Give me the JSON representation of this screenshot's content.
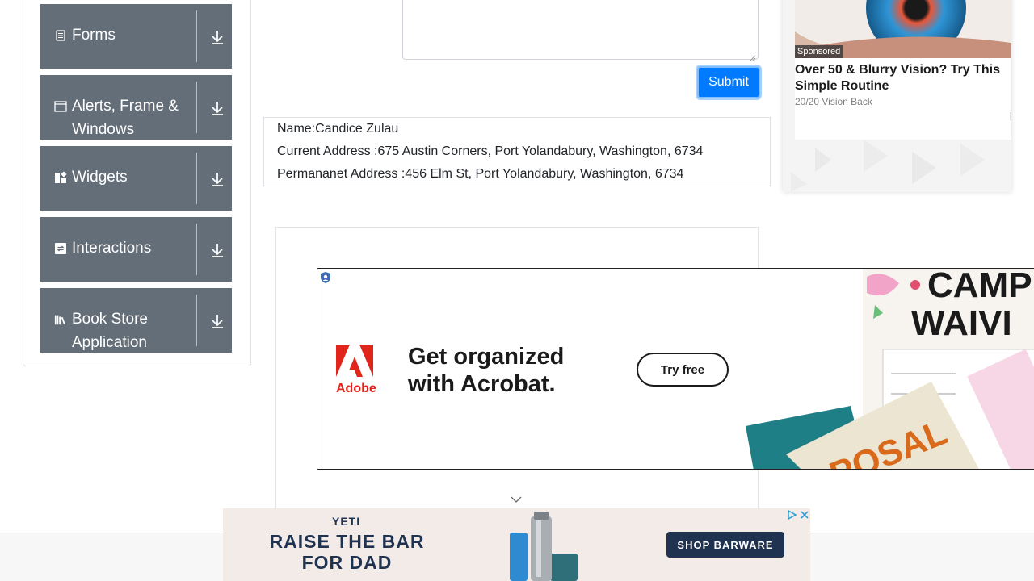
{
  "sidebar": {
    "groups": [
      {
        "label": "Forms",
        "icon": "document-icon"
      },
      {
        "label": "Alerts, Frame & Windows",
        "icon": "window-icon"
      },
      {
        "label": "Widgets",
        "icon": "widgets-icon"
      },
      {
        "label": "Interactions",
        "icon": "interactions-icon"
      },
      {
        "label": "Book Store Application",
        "icon": "books-icon"
      }
    ]
  },
  "form": {
    "submit_label": "Submit"
  },
  "output": {
    "name": "Name:Candice Zulau",
    "current_address": "Current Address :675 Austin Corners, Port Yolandabury, Washington, 6734",
    "permanent_address": "Permananet Address :456 Elm St, Port Yolandabury, Washington, 6734"
  },
  "ad_right": {
    "sponsored": "Sponsored",
    "headline": "Over 50 & Blurry Vision? Try This Simple Routine",
    "source": "20/20 Vision Back",
    "help": "[?]"
  },
  "ad_acrobat": {
    "logo_text": "Adobe",
    "headline": "Get organized with Acrobat.",
    "cta": "Try free"
  },
  "ad_yeti": {
    "brand": "YETI",
    "tagline": "RAISE THE BAR FOR DAD",
    "cta": "SHOP BARWARE"
  },
  "colors": {
    "sidebar_group_bg": "#646e78",
    "primary": "#007bff",
    "yeti_navy": "#1f3350",
    "adobe_red": "#e1251b"
  }
}
